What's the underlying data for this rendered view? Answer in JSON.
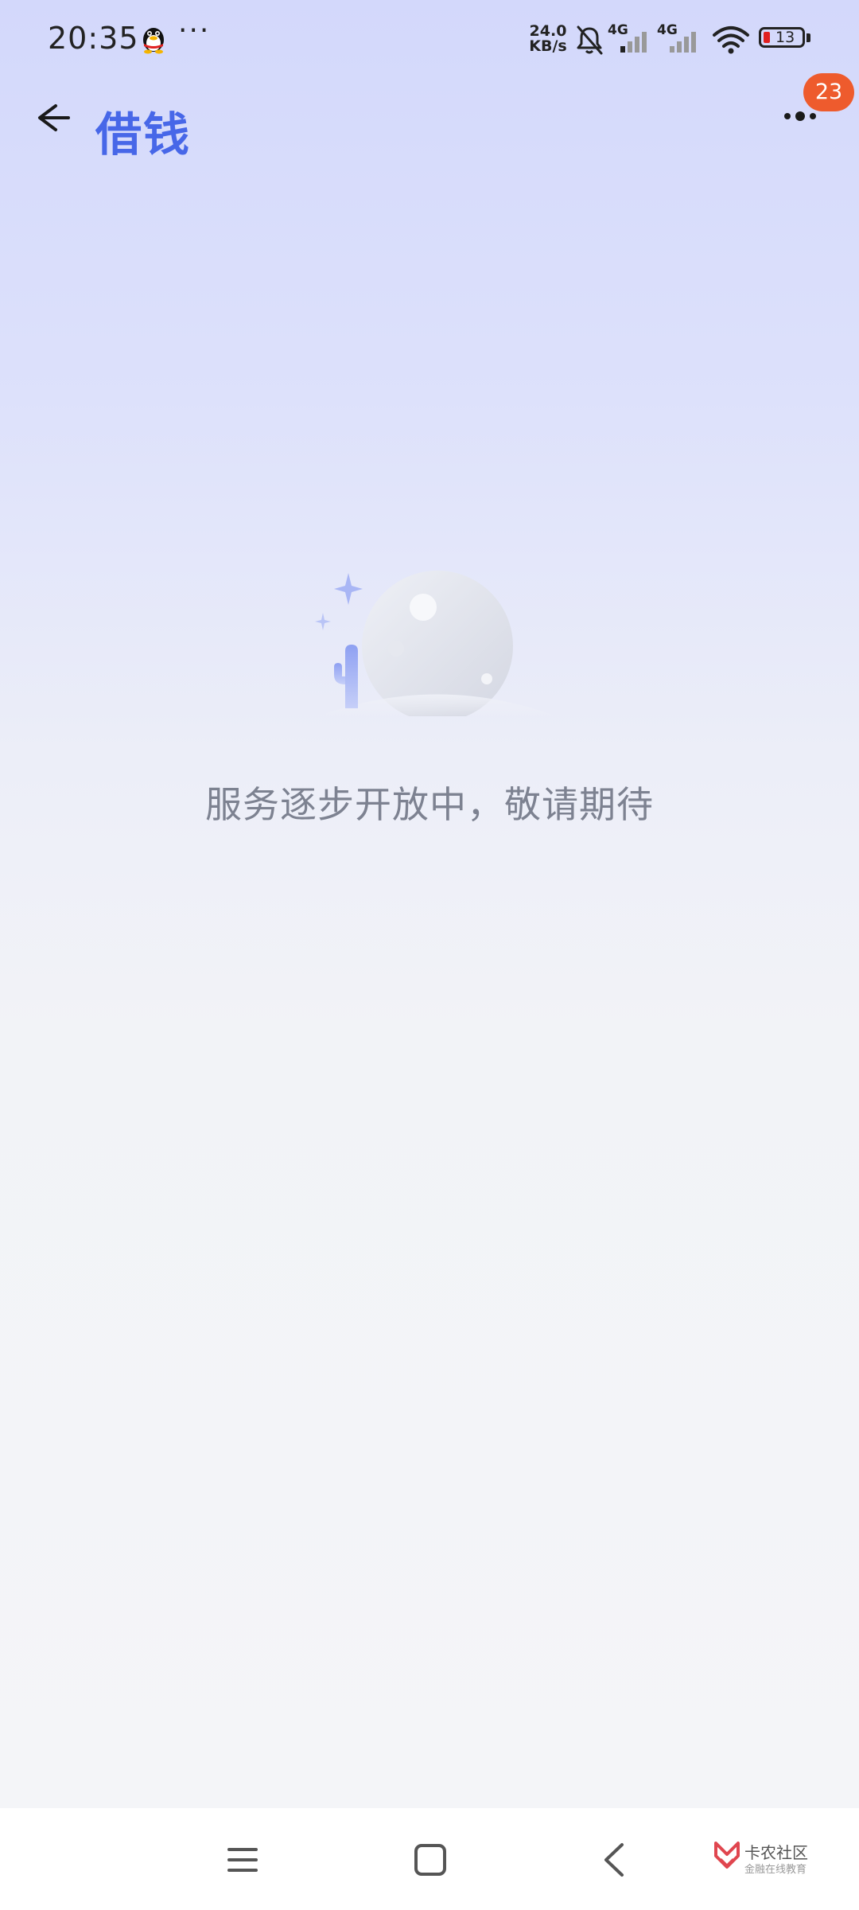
{
  "status_bar": {
    "time": "20:35",
    "more": "···",
    "net_speed_value": "24.0",
    "net_speed_unit": "KB/s",
    "signal_1_label": "4G",
    "signal_2_label": "4G",
    "battery_level": "13"
  },
  "header": {
    "title": "借钱",
    "badge_count": "23"
  },
  "empty_state": {
    "message": "服务逐步开放中，敬请期待"
  },
  "watermark": {
    "name": "卡农社区",
    "subtitle": "金融在线教育"
  },
  "colors": {
    "accent": "#4767e8",
    "badge": "#ee5b2d"
  },
  "icons": [
    "qq-icon",
    "bell-muted-icon",
    "signal-icon",
    "wifi-icon",
    "battery-icon",
    "back-arrow-icon",
    "more-dots-icon",
    "menu-icon",
    "home-icon",
    "back-icon"
  ]
}
